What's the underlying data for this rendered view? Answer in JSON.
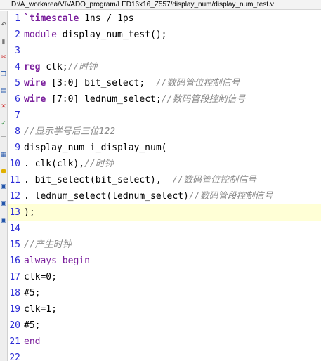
{
  "window": {
    "title": "D:/A_workarea/VIVADO_program/LED16x16_Z557/display_num/display_num_test.v"
  },
  "toolbar": {
    "buttons": [
      {
        "icon": "undo-icon",
        "glyph": "↶",
        "color": "#555555"
      },
      {
        "icon": "bookmark-icon",
        "glyph": "▮",
        "color": "#777777"
      },
      {
        "icon": "cut-icon",
        "glyph": "✂",
        "color": "#cc3333"
      },
      {
        "icon": "copy-icon",
        "glyph": "❐",
        "color": "#2255aa"
      },
      {
        "icon": "paste-icon",
        "glyph": "▤",
        "color": "#2255aa"
      },
      {
        "icon": "delete-icon",
        "glyph": "✕",
        "color": "#cc2222"
      },
      {
        "icon": "check-icon",
        "glyph": "✓",
        "color": "#228833"
      },
      {
        "icon": "indent-icon",
        "glyph": "☰",
        "color": "#444444"
      },
      {
        "icon": "comment-icon",
        "glyph": "▦",
        "color": "#2255aa"
      },
      {
        "icon": "lightbulb-icon",
        "glyph": "●",
        "color": "#e0b000"
      },
      {
        "icon": "block-icon",
        "glyph": "▣",
        "color": "#2255aa"
      },
      {
        "icon": "block-icon",
        "glyph": "▣",
        "color": "#2255aa"
      },
      {
        "icon": "block-icon",
        "glyph": "▣",
        "color": "#2255aa"
      }
    ]
  },
  "editor": {
    "current_line": 13,
    "lines": [
      {
        "num": "1",
        "tokens": [
          {
            "t": "`timescale",
            "c": "kw"
          },
          {
            "t": " 1ns / 1ps",
            "c": "plain"
          }
        ]
      },
      {
        "num": "2",
        "tokens": [
          {
            "t": "module",
            "c": "kw2"
          },
          {
            "t": " display_num_test();",
            "c": "plain"
          }
        ]
      },
      {
        "num": "3",
        "tokens": []
      },
      {
        "num": "4",
        "tokens": [
          {
            "t": "reg",
            "c": "kw"
          },
          {
            "t": " clk;",
            "c": "plain"
          },
          {
            "t": "//时钟",
            "c": "cmt"
          }
        ]
      },
      {
        "num": "5",
        "tokens": [
          {
            "t": "wire",
            "c": "kw"
          },
          {
            "t": " [3:0] bit_select;  ",
            "c": "plain"
          },
          {
            "t": "//数码管位控制信号",
            "c": "cmt"
          }
        ]
      },
      {
        "num": "6",
        "tokens": [
          {
            "t": "wire",
            "c": "kw"
          },
          {
            "t": " [7:0] lednum_select;",
            "c": "plain"
          },
          {
            "t": "//数码管段控制信号",
            "c": "cmt"
          }
        ]
      },
      {
        "num": "7",
        "tokens": []
      },
      {
        "num": "8",
        "tokens": [
          {
            "t": "//显示学号后三位122",
            "c": "cmt"
          }
        ]
      },
      {
        "num": "9",
        "tokens": [
          {
            "t": "display_num i_display_num(",
            "c": "plain"
          }
        ]
      },
      {
        "num": "10",
        "tokens": [
          {
            "t": ". clk(clk),",
            "c": "plain"
          },
          {
            "t": "//时钟",
            "c": "cmt"
          }
        ]
      },
      {
        "num": "11",
        "tokens": [
          {
            "t": ". bit_select(bit_select),  ",
            "c": "plain"
          },
          {
            "t": "//数码管位控制信号",
            "c": "cmt"
          }
        ]
      },
      {
        "num": "12",
        "tokens": [
          {
            "t": ". lednum_select(lednum_select)",
            "c": "plain"
          },
          {
            "t": "//数码管段控制信号",
            "c": "cmt"
          }
        ]
      },
      {
        "num": "13",
        "tokens": [
          {
            "t": ");",
            "c": "plain"
          }
        ]
      },
      {
        "num": "14",
        "tokens": []
      },
      {
        "num": "15",
        "tokens": [
          {
            "t": "//产生时钟",
            "c": "cmt"
          }
        ]
      },
      {
        "num": "16",
        "tokens": [
          {
            "t": "always begin",
            "c": "kw2"
          }
        ]
      },
      {
        "num": "17",
        "tokens": [
          {
            "t": "clk=0;",
            "c": "plain"
          }
        ]
      },
      {
        "num": "18",
        "tokens": [
          {
            "t": "#5;",
            "c": "plain"
          }
        ]
      },
      {
        "num": "19",
        "tokens": [
          {
            "t": "clk=1;",
            "c": "plain"
          }
        ]
      },
      {
        "num": "20",
        "tokens": [
          {
            "t": "#5;",
            "c": "plain"
          }
        ]
      },
      {
        "num": "21",
        "tokens": [
          {
            "t": "end",
            "c": "kw2"
          }
        ]
      },
      {
        "num": "22",
        "tokens": []
      }
    ]
  }
}
